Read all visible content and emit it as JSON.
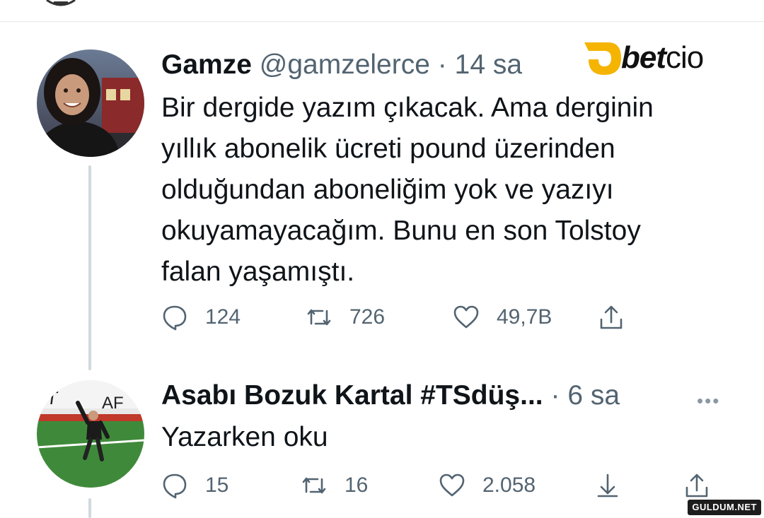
{
  "brand": {
    "name_bold": "bet",
    "name_light": "cio",
    "accent_color": "#f5b400"
  },
  "tweets": [
    {
      "author_name": "Gamze",
      "handle": "@gamzelerce",
      "separator": "·",
      "time": "14 sa",
      "text_lines": [
        "Bir dergide yazım çıkacak. Ama derginin",
        "yıllık abonelik ücreti pound üzerinden",
        "olduğundan aboneliğim yok ve yazıyı",
        "okuyamayacağım. Bunu en son Tolstoy",
        "falan yaşamıştı."
      ],
      "stats": {
        "replies": "124",
        "retweets": "726",
        "likes": "49,7B"
      }
    },
    {
      "author_name": "Asabı Bozuk Kartal #TSdüş...",
      "separator": "·",
      "time": "6 sa",
      "text_lines": [
        "Yazarken oku"
      ],
      "stats": {
        "replies": "15",
        "retweets": "16",
        "likes": "2.058"
      }
    }
  ],
  "more_label": "•••",
  "watermark": "GULDUM.NET",
  "colors": {
    "text": "#0f1419",
    "secondary": "#536471",
    "thread_line": "#cfd9de"
  }
}
